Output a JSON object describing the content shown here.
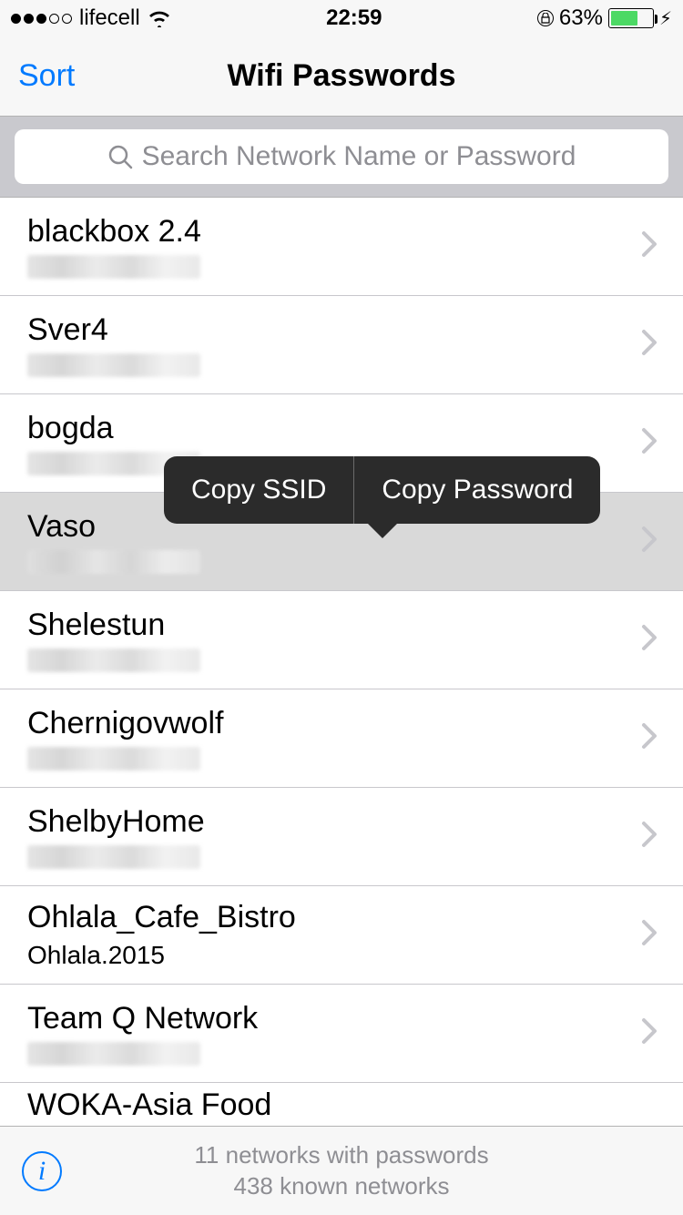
{
  "status": {
    "carrier": "lifecell",
    "time": "22:59",
    "battery_pct": "63%"
  },
  "nav": {
    "sort_label": "Sort",
    "title": "Wifi Passwords"
  },
  "search": {
    "placeholder": "Search Network Name or Password"
  },
  "context_menu": {
    "copy_ssid": "Copy SSID",
    "copy_password": "Copy Password"
  },
  "networks": [
    {
      "ssid": "blackbox 2.4",
      "password": "",
      "blurred": true
    },
    {
      "ssid": "Sver4",
      "password": "",
      "blurred": true
    },
    {
      "ssid": "bogda",
      "password": "",
      "blurred": true
    },
    {
      "ssid": "Vaso",
      "password": "",
      "blurred": true,
      "selected": true
    },
    {
      "ssid": "Shelestun",
      "password": "",
      "blurred": true
    },
    {
      "ssid": "Chernigovwolf",
      "password": "",
      "blurred": true
    },
    {
      "ssid": "ShelbyHome",
      "password": "",
      "blurred": true
    },
    {
      "ssid": "Ohlala_Cafe_Bistro",
      "password": "Ohlala.2015",
      "blurred": false
    },
    {
      "ssid": "Team Q Network",
      "password": "",
      "blurred": true
    },
    {
      "ssid": "WOKA-Asia Food",
      "password": "",
      "blurred": true,
      "partial": true
    }
  ],
  "footer": {
    "line1": "11 networks with passwords",
    "line2": "438 known networks"
  }
}
